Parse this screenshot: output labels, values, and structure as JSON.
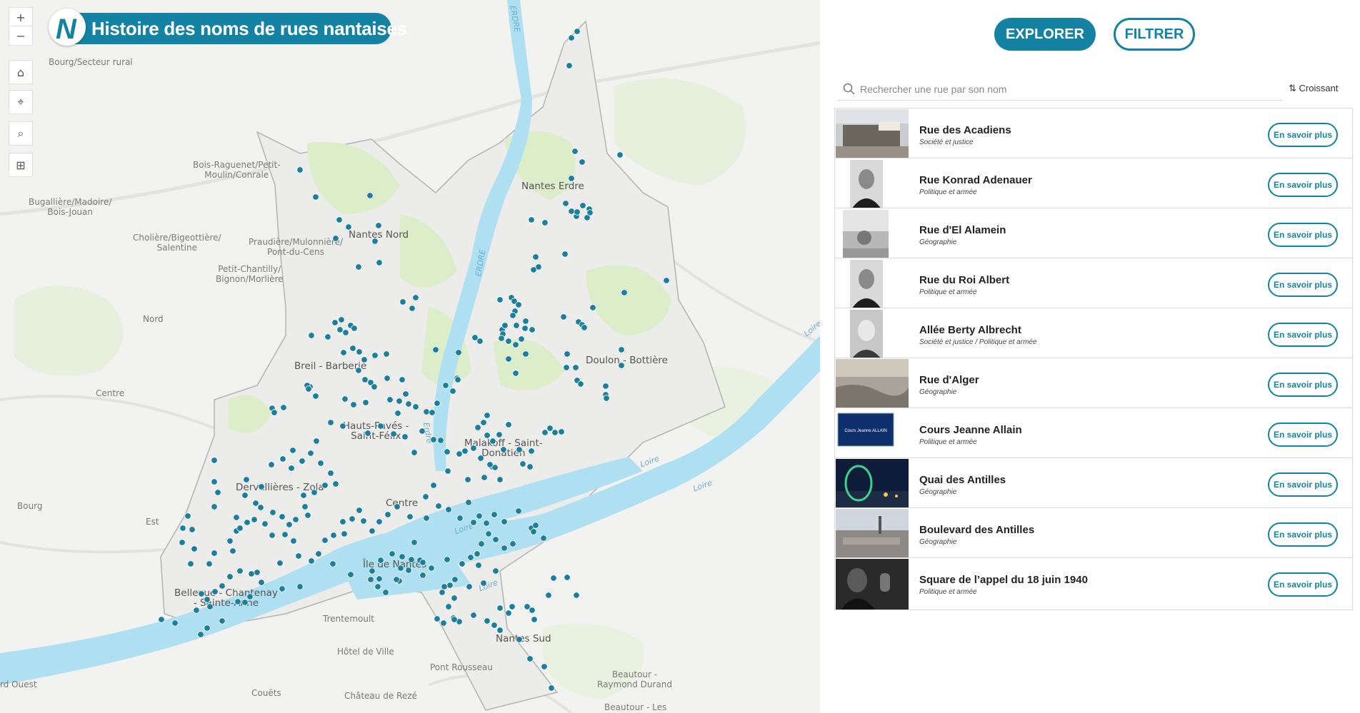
{
  "app": {
    "title": "Histoire des noms de rues nantaises",
    "logo_letter": "N",
    "brand_color": "#1483a3"
  },
  "map_tools": [
    {
      "name": "zoom-in",
      "icon": "plus-icon",
      "glyph": "+"
    },
    {
      "name": "zoom-out",
      "icon": "minus-icon",
      "glyph": "−"
    },
    {
      "name": "home",
      "icon": "home-icon",
      "glyph": "⌂"
    },
    {
      "name": "locate",
      "icon": "locate-icon",
      "glyph": "⌖"
    },
    {
      "name": "search",
      "icon": "search-icon",
      "glyph": "⌕"
    },
    {
      "name": "basemap",
      "icon": "grid-icon",
      "glyph": "⊞"
    }
  ],
  "map": {
    "places": {
      "bourg_secteur": "Bourg/Secteur rural",
      "bois_raguenet": "Bois-Raguenet/Petit-\nMoulin/Conrale",
      "bugalliere": "Bugallière/Madoire/\nBois-Jouan",
      "choliere": "Cholière/Bigeottière/\nSalentine",
      "praudiere": "Praudière/Mulonnière/\nPont-du-Cens",
      "petit_chantilly": "Petit-Chantilly/\nBignon/Morlière",
      "nord": "Nord",
      "centre_w": "Centre",
      "bourg_w": "Bourg",
      "est": "Est",
      "ouest": "rd Ouest",
      "trentemoult": "Trentemoult",
      "hotel_ville": "Hôtel de Ville",
      "pont_rousseau": "Pont Rousseau",
      "beautour": "Beautour -\nRaymond Durand",
      "couets": "Couëts",
      "chateau_reze": "Château de Rezé",
      "beautour_les": "Beautour - Les"
    },
    "districts": {
      "nantes_erdre": "Nantes Erdre",
      "nantes_nord": "Nantes Nord",
      "breil": "Breil - Barberie",
      "doulon": "Doulon - Bottière",
      "hauts_paves": "Hauts-Pavés -\nSaint-Félix",
      "malakoff": "Malakoff - Saint-\nDonatien",
      "dervallieres": "Dervallières - Zola",
      "centre": "Centre",
      "ile": "Île de Nantes",
      "bellevue": "Bellevue - Chantenay\n- Sainte-Anne",
      "nantes_sud": "Nantes Sud"
    },
    "rivers": {
      "erdre_top": "ERDRE",
      "erdre_mid": "ERDRE",
      "erdre_low": "Erdre",
      "loire_1": "Loire",
      "loire_2": "Loire",
      "loire_3": "Loire",
      "loire_4": "Loire",
      "loire_5": "Loire"
    },
    "point_color": "#1a7f9e"
  },
  "panel": {
    "explore_label": "EXPLORER",
    "filter_label": "FILTRER",
    "search_placeholder": "Rechercher une rue par son nom",
    "sort_label": "Croissant",
    "more_label": "En savoir plus",
    "streets": [
      {
        "name": "Rue des Acadiens",
        "category": "Société et justice",
        "thumb": "building"
      },
      {
        "name": "Rue Konrad Adenauer",
        "category": "Politique et armée",
        "thumb": "portrait"
      },
      {
        "name": "Rue d'El Alamein",
        "category": "Géographie",
        "thumb": "battle"
      },
      {
        "name": "Rue du Roi Albert",
        "category": "Politique et armée",
        "thumb": "portrait"
      },
      {
        "name": "Allée Berty Albrecht",
        "category": "Société et justice / Politique et armée",
        "thumb": "portrait-light"
      },
      {
        "name": "Rue d'Alger",
        "category": "Géographie",
        "thumb": "engraving"
      },
      {
        "name": "Cours Jeanne Allain",
        "category": "Politique et armée",
        "thumb": "sign",
        "sign_text": "Cours Jeanne ALLAIN"
      },
      {
        "name": "Quai des Antilles",
        "category": "Géographie",
        "thumb": "night"
      },
      {
        "name": "Boulevard des Antilles",
        "category": "Géographie",
        "thumb": "city"
      },
      {
        "name": "Square de l’appel du 18 juin 1940",
        "category": "Politique et armée",
        "thumb": "radio"
      }
    ]
  }
}
